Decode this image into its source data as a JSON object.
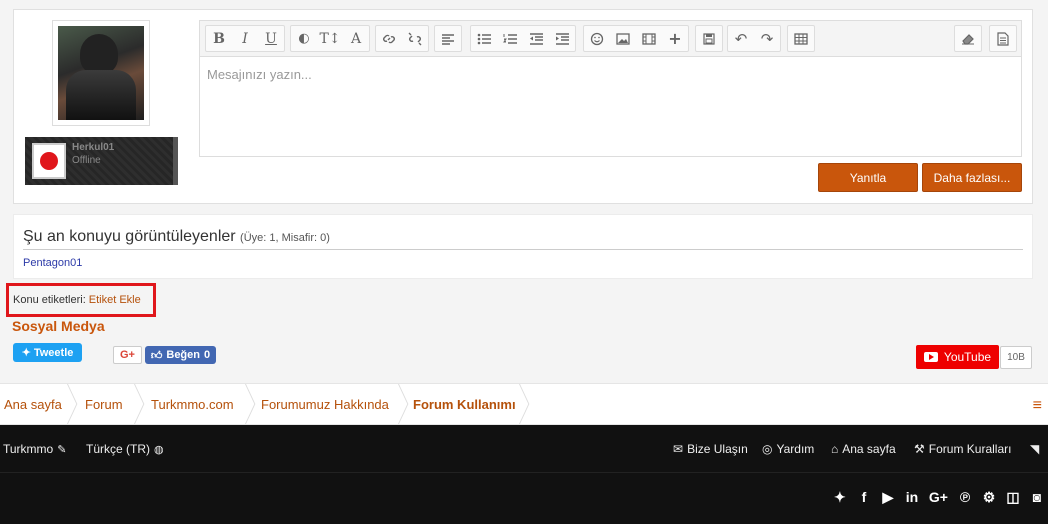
{
  "user": {
    "name": "Herkul01",
    "status": "Offline"
  },
  "editor": {
    "placeholder": "Mesajınızı yazın...",
    "toolbar": {
      "bold": "B",
      "italic": "I",
      "underline": "U",
      "color": "◐",
      "size": "T↕",
      "font": "A",
      "link": "🔗",
      "unlink": "⛓",
      "align": "≡",
      "bullets": "•≡",
      "numbers": "1≡",
      "outdent": "⇤",
      "indent": "⇥",
      "smilies": "☺",
      "image": "▣",
      "media": "▤",
      "insert": "+",
      "save": "▢",
      "undo": "↶",
      "redo": "↷",
      "table": "▦",
      "remove_format": "⌫",
      "source": "▯"
    }
  },
  "actions": {
    "reply": "Yanıtla",
    "more": "Daha fazlası..."
  },
  "viewers": {
    "title": "Şu an konuyu görüntüleyenler",
    "counts": "(Üye: 1, Misafir: 0)",
    "users": [
      "Pentagon01"
    ]
  },
  "tags": {
    "label": "Konu etiketleri:",
    "add_link": "Etiket Ekle"
  },
  "social": {
    "title": "Sosyal Medya",
    "tweet": "Tweetle",
    "gplus": "G+",
    "like": "Beğen",
    "like_count": "0",
    "youtube": "YouTube",
    "youtube_count": "10B"
  },
  "breadcrumb": [
    "Ana sayfa",
    "Forum",
    "Turkmmo.com",
    "Forumumuz Hakkında",
    "Forum Kullanımı"
  ],
  "footer": {
    "site": "Turkmmo",
    "language": "Türkçe (TR)",
    "links": [
      "Bize Ulaşın",
      "Yardım",
      "Ana sayfa",
      "Forum Kuralları"
    ]
  },
  "colors": {
    "accent": "#c9560c",
    "youtube": "#e00000",
    "twitter": "#1da1f2",
    "facebook": "#4267b2",
    "highlight": "#e0161b"
  }
}
